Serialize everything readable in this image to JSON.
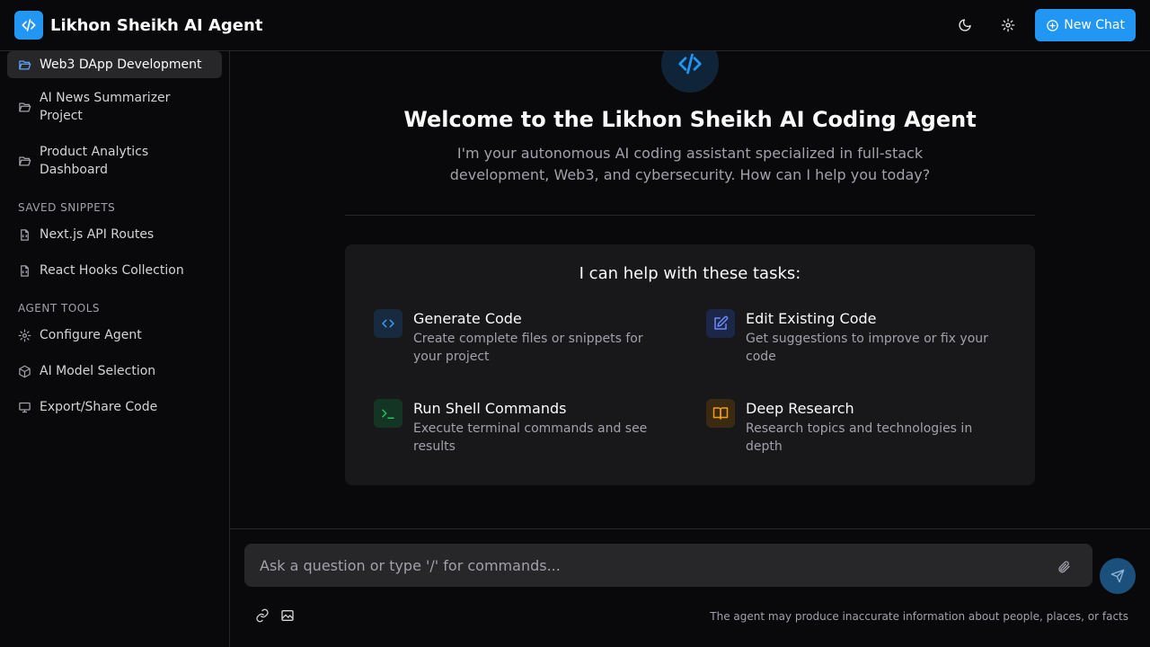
{
  "header": {
    "title": "Likhon Sheikh AI Agent",
    "new_chat_label": "New Chat",
    "icons": [
      "code-logo-icon",
      "moon-icon",
      "gear-icon",
      "plus-circle-icon"
    ]
  },
  "sidebar": {
    "projects": [
      {
        "label": "Web3 DApp Development",
        "icon": "folder-open-icon",
        "active": true
      },
      {
        "label": "AI News Summarizer Project",
        "icon": "folder-open-icon"
      },
      {
        "label": "Product Analytics Dashboard",
        "icon": "folder-open-icon"
      }
    ],
    "snippets_heading": "SAVED SNIPPETS",
    "snippets": [
      {
        "label": "Next.js API Routes",
        "icon": "file-code-icon"
      },
      {
        "label": "React Hooks Collection",
        "icon": "file-code-icon"
      }
    ],
    "tools_heading": "AGENT TOOLS",
    "tools": [
      {
        "label": "Configure Agent",
        "icon": "gear-icon"
      },
      {
        "label": "AI Model Selection",
        "icon": "cube-icon"
      },
      {
        "label": "Export/Share Code",
        "icon": "monitor-icon"
      }
    ]
  },
  "main": {
    "welcome": "Welcome to the Likhon Sheikh AI Coding Agent",
    "subtitle": "I'm your autonomous AI coding assistant specialized in full-stack development, Web3, and cybersecurity. How can I help you today?",
    "tasks_heading": "I can help with these tasks:",
    "tasks": [
      {
        "title": "Generate Code",
        "desc": "Create complete files or snippets for your project",
        "icon": "code-icon"
      },
      {
        "title": "Edit Existing Code",
        "desc": "Get suggestions to improve or fix your code",
        "icon": "edit-icon"
      },
      {
        "title": "Run Shell Commands",
        "desc": "Execute terminal commands and see results",
        "icon": "terminal-icon"
      },
      {
        "title": "Deep Research",
        "desc": "Research topics and technologies in depth",
        "icon": "book-open-icon"
      }
    ]
  },
  "composer": {
    "placeholder": "Ask a question or type '/' for commands...",
    "disclaimer": "The agent may produce inaccurate information about people, places, or facts"
  },
  "colors": {
    "accent": "#2196f3",
    "background": "#09090b",
    "card": "#18181b",
    "green": "#22c55e",
    "amber": "#f59e0b"
  }
}
